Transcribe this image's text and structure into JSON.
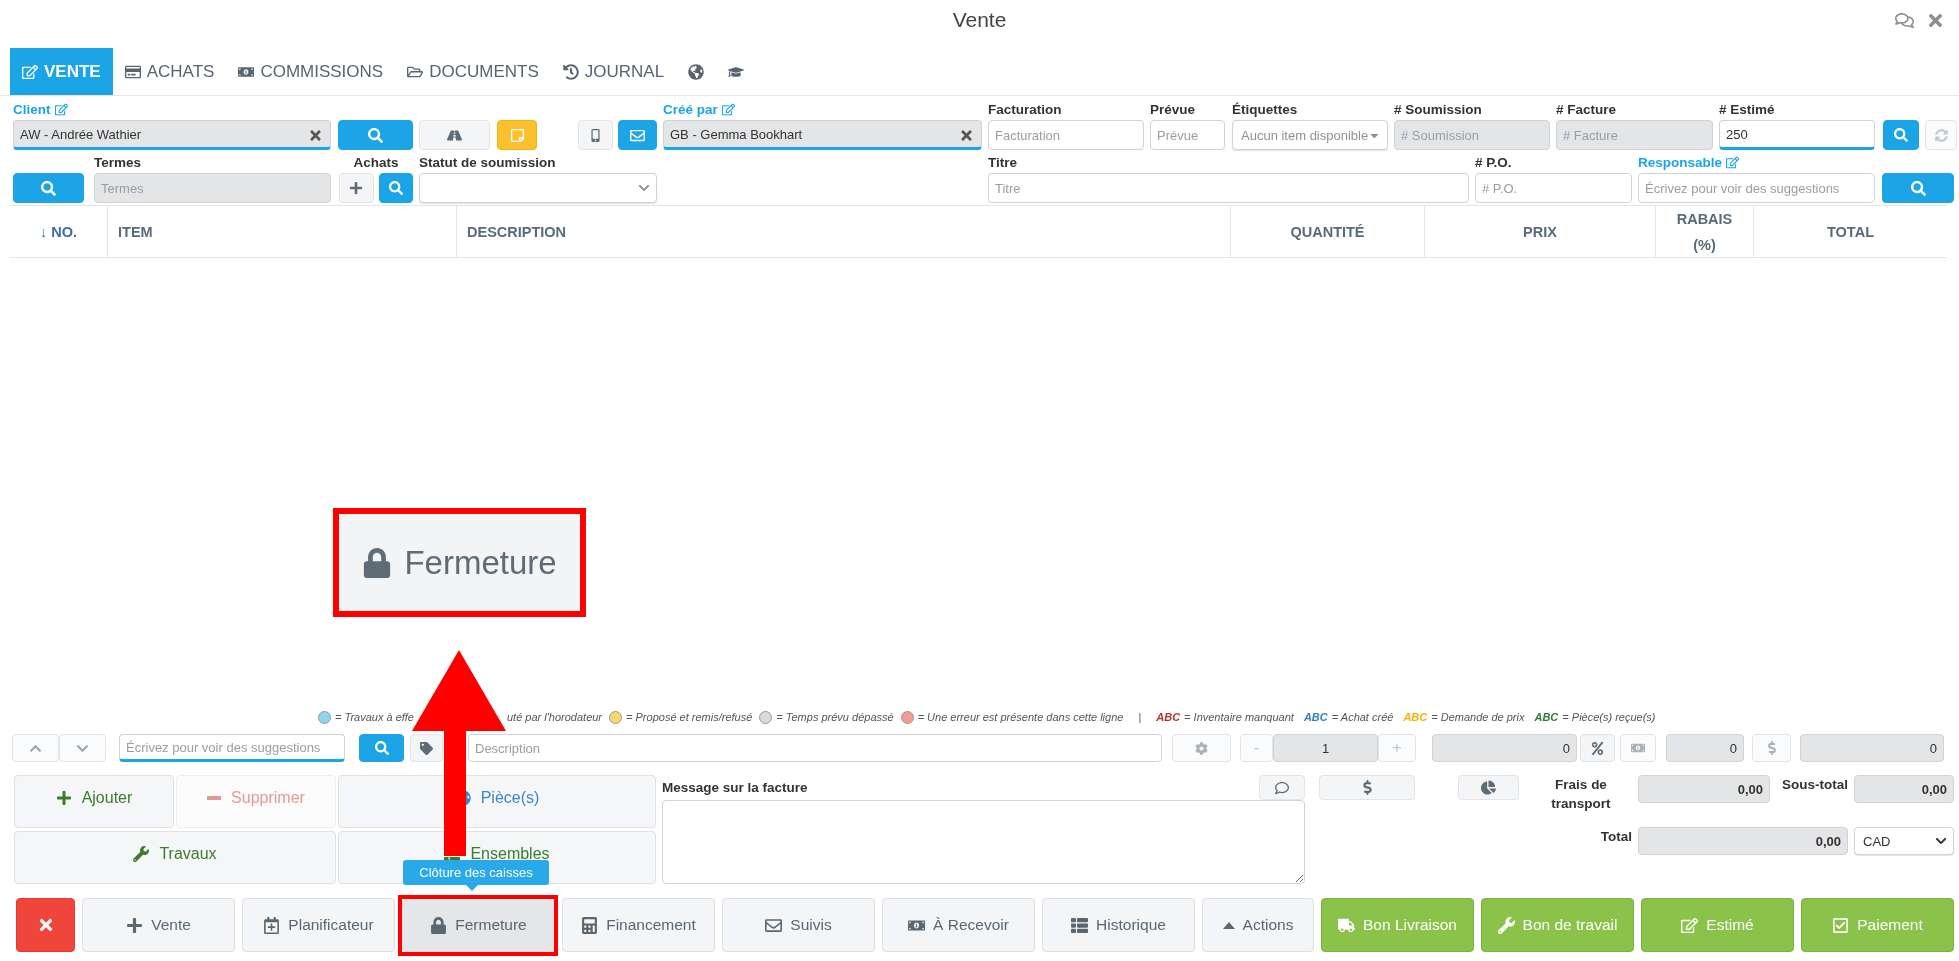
{
  "window": {
    "title": "Vente"
  },
  "tabs": [
    {
      "label": "VENTE",
      "selected": true
    },
    {
      "label": "ACHATS",
      "selected": false
    },
    {
      "label": "COMMISSIONS",
      "selected": false
    },
    {
      "label": "DOCUMENTS",
      "selected": false
    },
    {
      "label": "JOURNAL",
      "selected": false
    }
  ],
  "icon_tabs": [
    {
      "selected": false
    },
    {
      "selected": false
    }
  ],
  "header": {
    "client": {
      "label": "Client",
      "value": "AW - Andrée Wathier"
    },
    "cree_par": {
      "label": "Créé par",
      "value": "GB - Gemma Bookhart"
    },
    "facturation": {
      "label": "Facturation",
      "placeholder": "Facturation"
    },
    "prevue": {
      "label": "Prévue",
      "placeholder": "Prévue"
    },
    "etiquettes": {
      "label": "Étiquettes",
      "value": "Aucun item disponible"
    },
    "soumission": {
      "label": "# Soumission",
      "placeholder": "# Soumission"
    },
    "facture": {
      "label": "# Facture",
      "placeholder": "# Facture"
    },
    "estime": {
      "label": "# Estimé",
      "value": "250"
    },
    "termes": {
      "label": "Termes",
      "placeholder": "Termes"
    },
    "achats": {
      "label": "Achats"
    },
    "statut": {
      "label": "Statut de soumission"
    },
    "titre": {
      "label": "Titre",
      "placeholder": "Titre"
    },
    "po": {
      "label": "# P.O.",
      "placeholder": "# P.O."
    },
    "responsable": {
      "label": "Responsable",
      "placeholder": "Écrivez pour voir des suggestions"
    }
  },
  "table": {
    "columns": [
      "↓ NO.",
      "ITEM",
      "DESCRIPTION",
      "QUANTITÉ",
      "PRIX",
      "RABAIS (%)",
      "TOTAL"
    ]
  },
  "legend": {
    "items": [
      {
        "kind": "dot",
        "color": "#8fd3f4",
        "text": "= Travaux à effe"
      },
      {
        "kind": "text",
        "text": "uté par l'horodateur"
      },
      {
        "kind": "dot",
        "color": "#f7d96b",
        "text": "= Proposé et remis/refusé"
      },
      {
        "kind": "dot",
        "color": "#d9dcdf",
        "text": "= Temps prévu dépassé"
      },
      {
        "kind": "dot",
        "color": "#f29a94",
        "text": "= Une erreur est présente dans cette ligne"
      },
      {
        "kind": "separator",
        "text": "|"
      },
      {
        "kind": "code",
        "color": "#b5332e",
        "code": "ABC",
        "text": "= Inventaire manquant"
      },
      {
        "kind": "code",
        "color": "#2f7fc4",
        "code": "ABC",
        "text": "= Achat créé"
      },
      {
        "kind": "code",
        "color": "#f5b400",
        "code": "ABC",
        "text": "= Demande de prix"
      },
      {
        "kind": "code",
        "color": "#2e7d32",
        "code": "ABC",
        "text": "= Pièce(s) reçue(s)"
      }
    ]
  },
  "line_entry": {
    "search_placeholder": "Écrivez pour voir des suggestions",
    "description_placeholder": "Description",
    "minus": "-",
    "quantity": "1",
    "plus": "+",
    "price": "0",
    "discount": "0",
    "total": "0"
  },
  "actions": [
    {
      "label": "Ajouter",
      "color": "#3c7a2e",
      "disabled": false
    },
    {
      "label": "Supprimer",
      "color": "#e39a95",
      "disabled": true
    },
    {
      "label": "Pièce(s)",
      "color": "#3a87c8",
      "disabled": false
    },
    {
      "label": "Travaux",
      "color": "#3c7a2e",
      "disabled": false
    },
    {
      "label": "Ensembles",
      "color": "#3c7a2e",
      "disabled": false
    }
  ],
  "message": {
    "label": "Message sur la facture"
  },
  "totals": {
    "shipping_label": "Frais de transport",
    "shipping": "0,00",
    "subtotal_label": "Sous-total",
    "subtotal": "0,00",
    "total_label": "Total",
    "total": "0,00",
    "currency": "CAD"
  },
  "bottom_buttons": [
    {
      "kind": "danger"
    },
    {
      "kind": "default",
      "label": "Vente",
      "highlighted": false
    },
    {
      "kind": "default",
      "label": "Planificateur",
      "highlighted": false
    },
    {
      "kind": "default",
      "label": "Fermeture",
      "highlighted": true
    },
    {
      "kind": "default",
      "label": "Financement",
      "highlighted": false
    },
    {
      "kind": "default",
      "label": "Suivis",
      "highlighted": false
    },
    {
      "kind": "default",
      "label": "À Recevoir",
      "highlighted": false
    },
    {
      "kind": "default",
      "label": "Historique",
      "highlighted": false
    },
    {
      "kind": "default",
      "label": "Actions",
      "highlighted": false
    },
    {
      "kind": "success",
      "label": "Bon Livraison"
    },
    {
      "kind": "success",
      "label": "Bon de travail"
    },
    {
      "kind": "success",
      "label": "Estimé"
    },
    {
      "kind": "success",
      "label": "Paiement"
    }
  ],
  "tooltip": {
    "text": "Clôture des caisses"
  },
  "callout": {
    "label": "Fermeture"
  }
}
